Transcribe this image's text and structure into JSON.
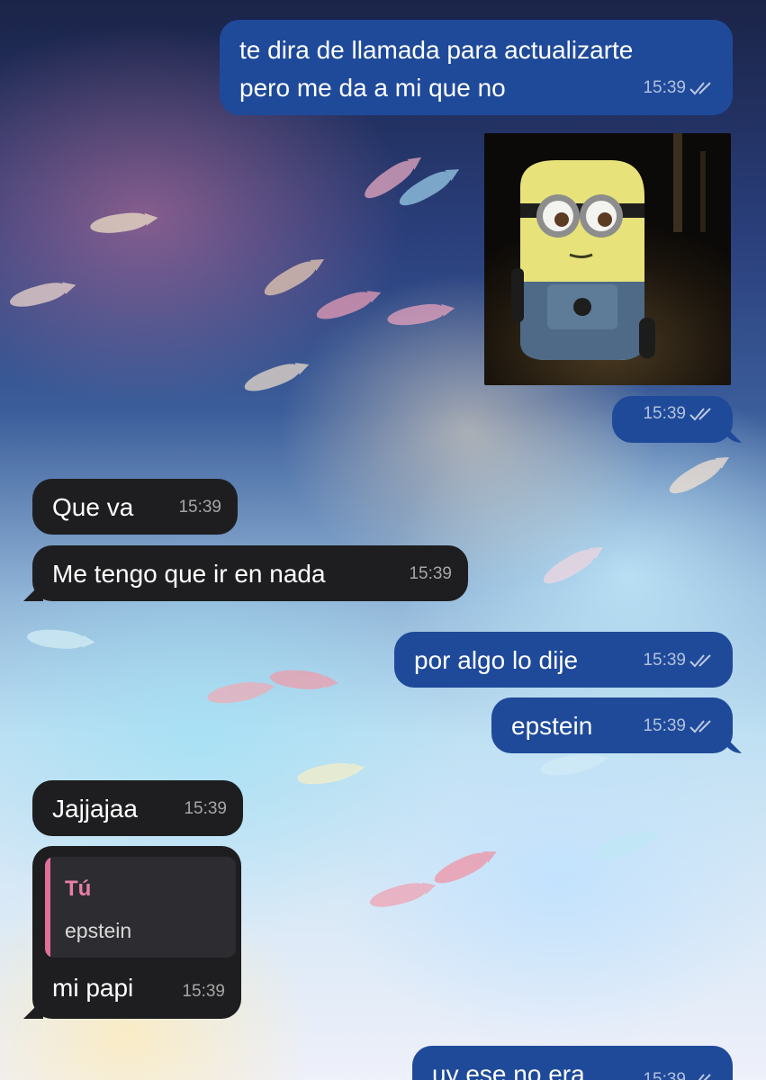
{
  "chat": {
    "messages": [
      {
        "id": "m1",
        "direction": "outgoing",
        "lines": [
          "te dira de llamada para actualizarte",
          "pero me da a mi que no"
        ],
        "time": "15:39",
        "read": true
      },
      {
        "id": "m2",
        "direction": "outgoing",
        "type": "photo",
        "photo_subject": "minion",
        "time": "15:39",
        "read": true
      },
      {
        "id": "m3",
        "direction": "incoming",
        "text": "Que va",
        "time": "15:39"
      },
      {
        "id": "m4",
        "direction": "incoming",
        "text": "Me tengo que ir en nada",
        "time": "15:39"
      },
      {
        "id": "m5",
        "direction": "outgoing",
        "text": "por algo lo dije",
        "time": "15:39",
        "read": true
      },
      {
        "id": "m6",
        "direction": "outgoing",
        "text": "epstein",
        "time": "15:39",
        "read": true
      },
      {
        "id": "m7",
        "direction": "incoming",
        "text": "Jajjajaa",
        "time": "15:39"
      },
      {
        "id": "m8",
        "direction": "incoming",
        "reply_to": {
          "author": "Tú",
          "text": "epstein"
        },
        "text": "mi papi",
        "time": "15:39"
      },
      {
        "id": "m9",
        "direction": "outgoing",
        "text": "uy ese no era",
        "time": "15:39",
        "read": true
      }
    ]
  },
  "colors": {
    "outgoing_bubble": "#1f4a9a",
    "incoming_bubble": "#1e1e20",
    "reply_accent": "#e0709a"
  },
  "icons": {
    "read_receipt": "double-check-icon"
  }
}
